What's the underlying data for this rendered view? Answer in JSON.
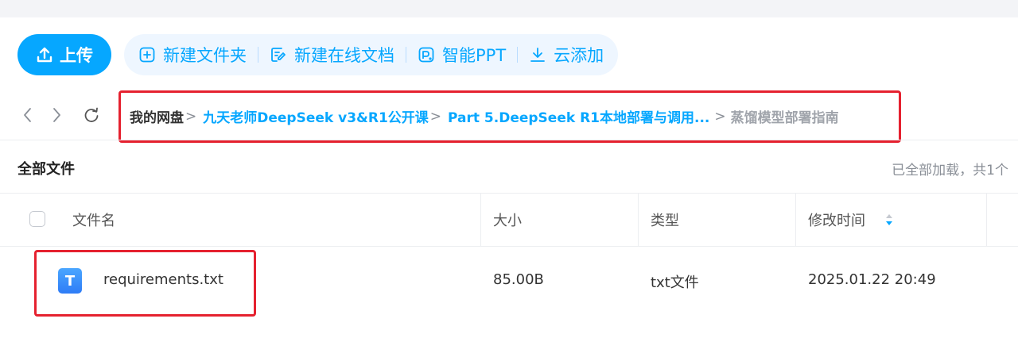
{
  "toolbar": {
    "upload_label": "上传",
    "actions": [
      {
        "label": "新建文件夹",
        "icon": "plus-square-icon"
      },
      {
        "label": "新建在线文档",
        "icon": "edit-doc-icon"
      },
      {
        "label": "智能PPT",
        "icon": "ppt-icon"
      },
      {
        "label": "云添加",
        "icon": "download-icon"
      }
    ]
  },
  "breadcrumb": {
    "home": "我的网盘",
    "items": [
      "九天老师DeepSeek v3&R1公开课",
      "Part 5.DeepSeek R1本地部署与调用..."
    ],
    "current": "蒸馏模型部署指南",
    "separator": ">"
  },
  "files": {
    "title": "全部文件",
    "status": "已全部加载，共1个"
  },
  "table": {
    "columns": {
      "name": "文件名",
      "size": "大小",
      "type": "类型",
      "modified": "修改时间"
    },
    "rows": [
      {
        "icon_letter": "T",
        "name": "requirements.txt",
        "size": "85.00B",
        "type": "txt文件",
        "modified": "2025.01.22 20:49"
      }
    ]
  },
  "colors": {
    "accent": "#06a7ff",
    "highlight": "#e5212f",
    "file_icon": "#2e7cf6"
  }
}
